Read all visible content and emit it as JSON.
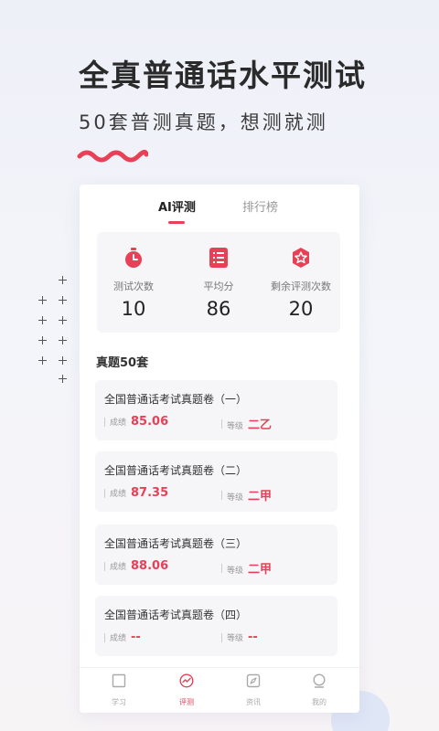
{
  "hero": {
    "title": "全真普通话水平测试",
    "subtitle": "50套普测真题，想测就测"
  },
  "colors": {
    "accent": "#e84057",
    "text": "#2a2a2a",
    "muted": "#999999",
    "panel": "#f6f6f8"
  },
  "tabs": [
    {
      "label": "AI评测",
      "active": true
    },
    {
      "label": "排行榜",
      "active": false
    }
  ],
  "stats": [
    {
      "label": "测试次数",
      "value": "10",
      "icon": "stopwatch-icon"
    },
    {
      "label": "平均分",
      "value": "86",
      "icon": "list-icon"
    },
    {
      "label": "剩余评测次数",
      "value": "20",
      "icon": "star-badge-icon"
    }
  ],
  "section_title": "真题50套",
  "papers": [
    {
      "title": "全国普通话考试真题卷（一）",
      "score_label": "成绩",
      "score": "85.06",
      "grade_label": "等级",
      "grade": "二乙"
    },
    {
      "title": "全国普通话考试真题卷（二）",
      "score_label": "成绩",
      "score": "87.35",
      "grade_label": "等级",
      "grade": "二甲"
    },
    {
      "title": "全国普通话考试真题卷（三）",
      "score_label": "成绩",
      "score": "88.06",
      "grade_label": "等级",
      "grade": "二甲"
    },
    {
      "title": "全国普通话考试真题卷（四）",
      "score_label": "成绩",
      "score": "--",
      "grade_label": "等级",
      "grade": "--"
    }
  ],
  "nav": [
    {
      "label": "学习",
      "icon": "square-icon",
      "active": false
    },
    {
      "label": "评测",
      "icon": "trend-circle-icon",
      "active": true
    },
    {
      "label": "资讯",
      "icon": "compass-icon",
      "active": false
    },
    {
      "label": "我的",
      "icon": "profile-icon",
      "active": false
    }
  ]
}
